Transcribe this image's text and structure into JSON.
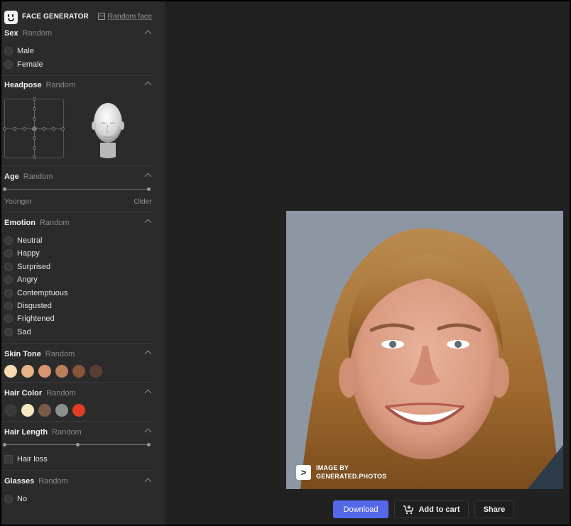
{
  "header": {
    "brand": "FACE GENERATOR",
    "random_face": "Random face"
  },
  "sections": {
    "sex": {
      "title": "Sex",
      "sub": "Random",
      "options": [
        "Male",
        "Female"
      ]
    },
    "headpose": {
      "title": "Headpose",
      "sub": "Random"
    },
    "age": {
      "title": "Age",
      "sub": "Random",
      "min_label": "Younger",
      "max_label": "Older"
    },
    "emotion": {
      "title": "Emotion",
      "sub": "Random",
      "options": [
        "Neutral",
        "Happy",
        "Surprised",
        "Angry",
        "Contemptuous",
        "Disgusted",
        "Frightened",
        "Sad"
      ]
    },
    "skin_tone": {
      "title": "Skin Tone",
      "sub": "Random",
      "colors": [
        "#f4dcb0",
        "#e6b384",
        "#d99470",
        "#b97e57",
        "#8a5438",
        "#5a3d34"
      ]
    },
    "hair_color": {
      "title": "Hair Color",
      "sub": "Random",
      "colors": [
        "#3a3a3a",
        "#f6e7c1",
        "#7a5a44",
        "#8e8e8e",
        "#e23d23"
      ]
    },
    "hair_length": {
      "title": "Hair Length",
      "sub": "Random",
      "checkbox": "Hair loss"
    },
    "glasses": {
      "title": "Glasses",
      "sub": "Random",
      "options": [
        "No"
      ]
    }
  },
  "image": {
    "watermark_line1": "IMAGE BY",
    "watermark_line2": "GENERATED.PHOTOS"
  },
  "actions": {
    "download": "Download",
    "add_to_cart": "Add to cart",
    "share": "Share"
  }
}
